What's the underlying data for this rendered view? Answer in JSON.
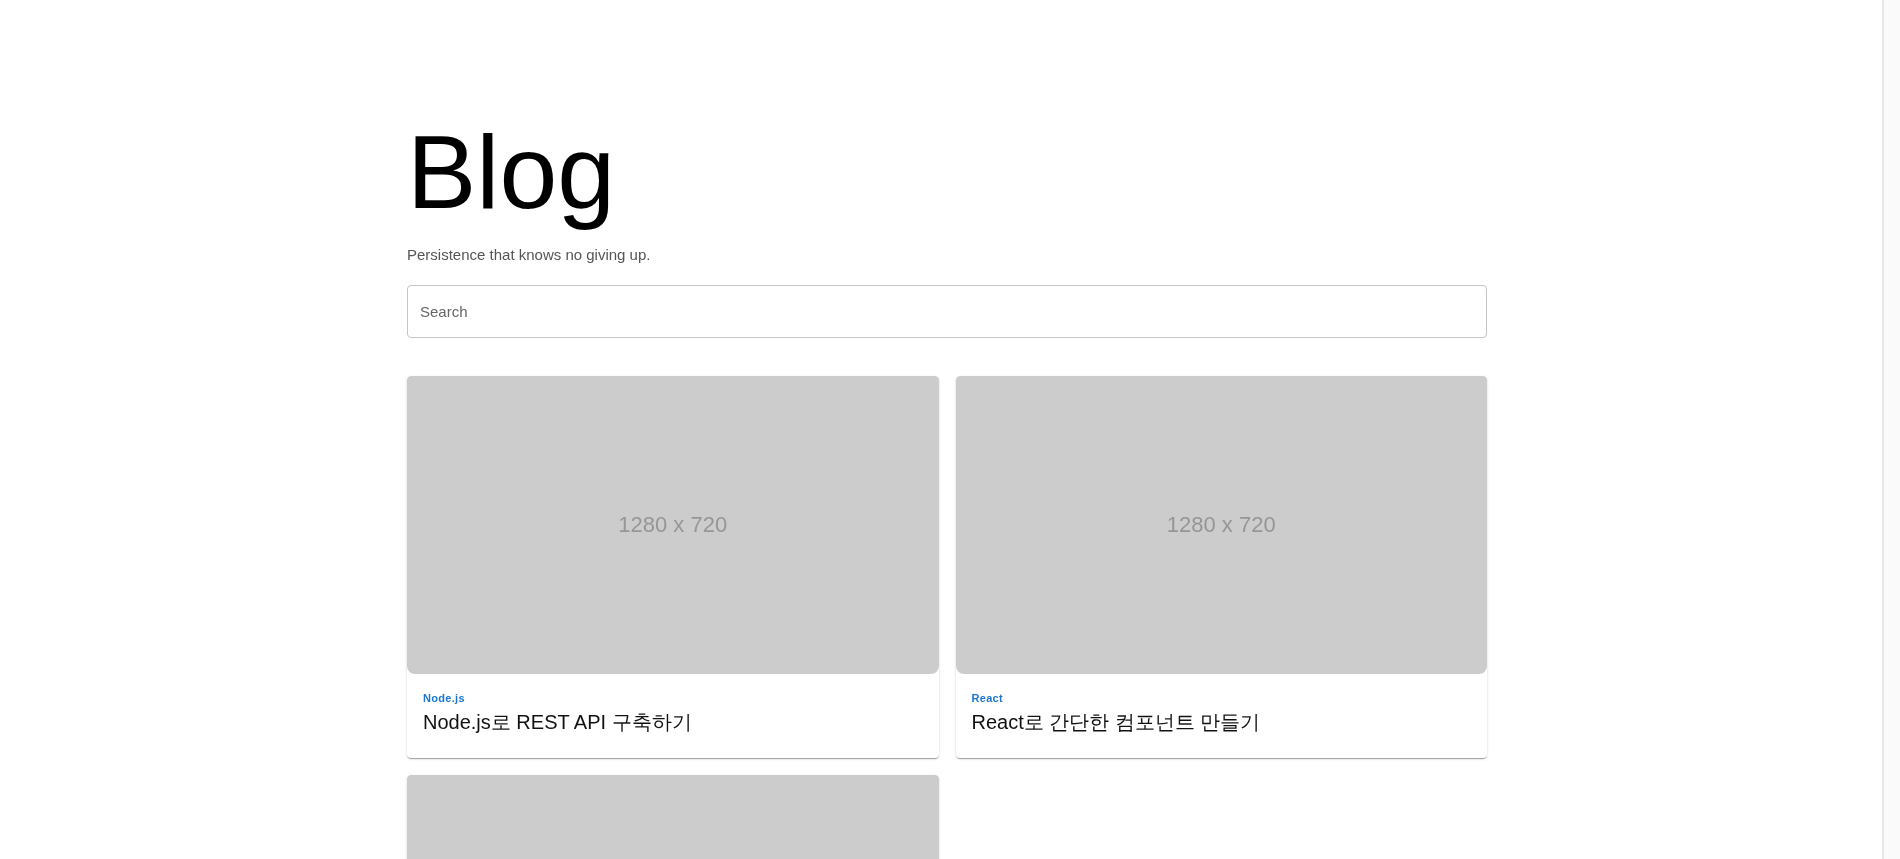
{
  "header": {
    "title": "Blog",
    "subtitle": "Persistence that knows no giving up."
  },
  "search": {
    "placeholder": "Search"
  },
  "posts": [
    {
      "kind": "full",
      "image_text": "1280 x 720",
      "category": "Node.js",
      "title": "Node.js로 REST API 구축하기"
    },
    {
      "kind": "full",
      "image_text": "1280 x 720",
      "category": "React",
      "title": "React로 간단한 컴포넌트 만들기"
    },
    {
      "kind": "image_only"
    }
  ]
}
